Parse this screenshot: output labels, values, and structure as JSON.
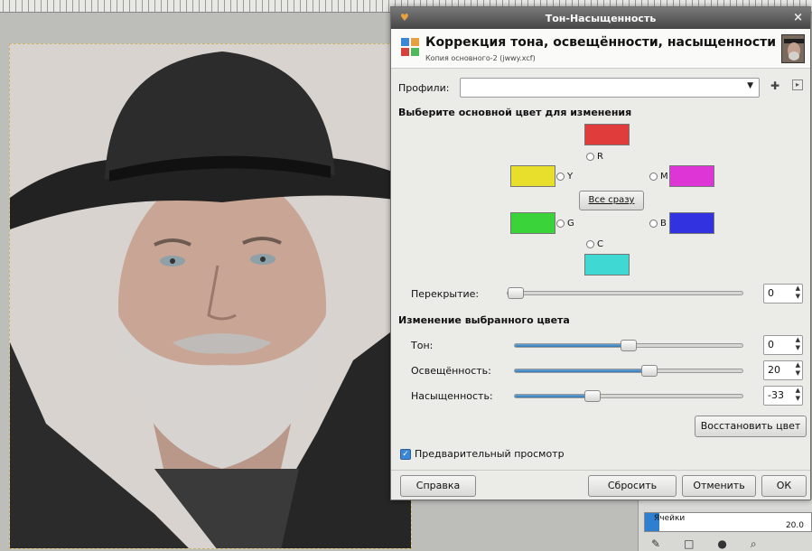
{
  "dialog": {
    "title": "Тон-Насыщенность",
    "close_glyph": "×",
    "header_title": "Коррекция тона, освещённости, насыщенности",
    "header_subtitle": "Копия основного-2 (jwwy.xcf)",
    "profiles_label": "Профили:",
    "profiles_value": "",
    "select_color_title": "Выберите основной цвет для изменения",
    "colors": {
      "r": {
        "label": "R",
        "color": "#e03c3c"
      },
      "y": {
        "label": "Y",
        "color": "#e8df2c"
      },
      "m": {
        "label": "M",
        "color": "#de35d6"
      },
      "g": {
        "label": "G",
        "color": "#3ad43a"
      },
      "b": {
        "label": "B",
        "color": "#3232e0"
      },
      "c": {
        "label": "C",
        "color": "#3fd8d3"
      }
    },
    "all_button": "Все сразу",
    "overlap": {
      "label": "Перекрытие:",
      "value": "0",
      "fraction": 0.0
    },
    "change_title": "Изменение выбранного цвета",
    "hue": {
      "label": "Тон:",
      "value": "0",
      "fraction": 0.5
    },
    "lightness": {
      "label": "Освещённость:",
      "value": "20",
      "fraction": 0.6
    },
    "saturation": {
      "label": "Насыщенность:",
      "value": "-33",
      "fraction": 0.33
    },
    "reset_color_button": "Восстановить цвет",
    "preview_label": "Предварительный просмотр",
    "preview_checked": true,
    "buttons": {
      "help": "Справка",
      "reset": "Сбросить",
      "cancel": "Отменить",
      "ok": "ОК"
    }
  },
  "layers_panel": {
    "label": "Ячейки",
    "value": "20.0",
    "accent": "#2f7fd1"
  }
}
